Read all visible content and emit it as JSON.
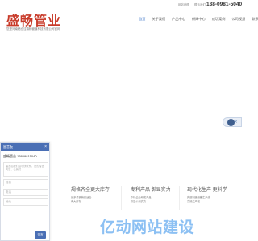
{
  "header": {
    "logo": "盛畅管业",
    "logo_subtitle": "您是河南稿仓洼镇畅管道科技有限公司官网",
    "phone": "138-0981-5040",
    "util_links": [
      "网站地图",
      "联系我们"
    ]
  },
  "nav": {
    "items": [
      "首页",
      "关于我们",
      "产品中心",
      "新闻中心",
      "成功案例",
      "公司视频",
      "联系我们"
    ],
    "active_index": 0
  },
  "chat": {
    "title": "留言板",
    "company": "盛畅管业 13809815040",
    "message_placeholder": "留言后我们会尽快联系，您的留言内容，让我们...",
    "fields": [
      "姓名",
      "电话",
      "地址"
    ],
    "submit_label": "留言"
  },
  "features": [
    {
      "title": "规格齐全更大库存",
      "desc": [
        "最多量钢管最适合",
        "有大库存"
      ]
    },
    {
      "title": "专利产品 彰显实力",
      "desc": [
        "中标企业研发产品",
        "彰显公司实力"
      ]
    },
    {
      "title": "现代化生产 更科学",
      "desc": [
        "先进制造设备生产线",
        "高效生产线"
      ]
    }
  ],
  "watermark": "亿动网站建设",
  "colors": {
    "brand": "#c83b2a",
    "accent": "#4a6fb5",
    "nav_active": "#1f5fbf"
  }
}
